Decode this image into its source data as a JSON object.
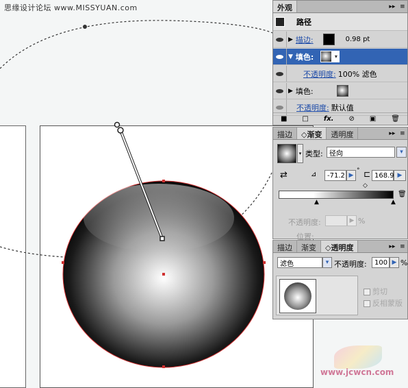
{
  "watermark": "思缘设计论坛 www.MISSYUAN.com",
  "appearance_panel": {
    "title": "外观",
    "header": "路径",
    "stroke_label": "描边:",
    "stroke_value": "0.98 pt",
    "fill_label_selected": "填色:",
    "opacity_label": "不透明度:",
    "opacity_value": "100% 滤色",
    "fill_label": "填色:",
    "opacity_label_2": "不透明度:",
    "opacity_value_2": "默认值",
    "buttons": [
      "■",
      "□",
      "fx.",
      "⊘",
      "▣",
      "🗑"
    ]
  },
  "gradient_panel": {
    "tabs": [
      "描边",
      "◇渐变",
      "透明度"
    ],
    "type_label": "类型:",
    "type_value": "径向",
    "angle_value": "-71.2",
    "degree_symbol": "°",
    "aspect_value": "168.98",
    "opacity_label": "不透明度:",
    "percent": "%",
    "position_label": "位置:"
  },
  "transparency_panel": {
    "tabs": [
      "描边",
      "渐变",
      "◇透明度"
    ],
    "blend_mode": "滤色",
    "opacity_label": "不透明度:",
    "opacity_value": "100",
    "percent": "%",
    "clip_label": "剪切",
    "invert_mask_label": "反相蒙版"
  },
  "watermark_bottom": "www.jcwcn.com",
  "colors": {
    "selection": "#3264b4",
    "path_red": "#e03030",
    "panel_bg": "#d4d4d4"
  }
}
